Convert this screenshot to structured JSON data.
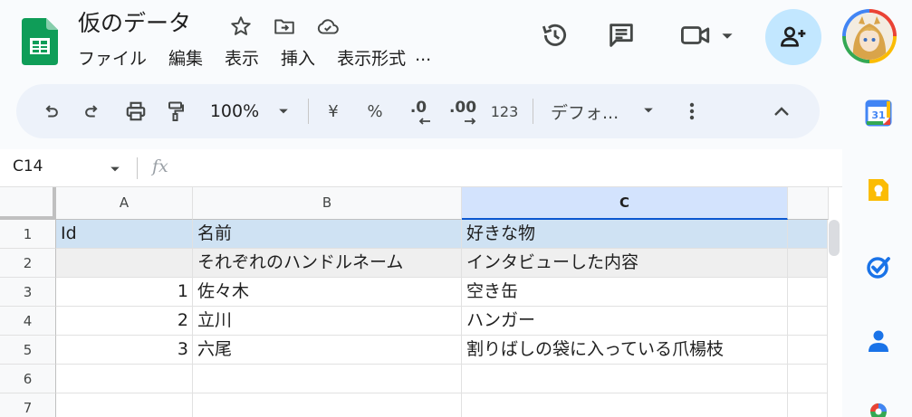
{
  "document": {
    "title": "仮のデータ"
  },
  "menu": [
    "ファイル",
    "編集",
    "表示",
    "挿入",
    "表示形式",
    "..."
  ],
  "toolbar": {
    "zoom": "100%",
    "currency": "¥",
    "percent": "%",
    "decrease_decimal": ".0",
    "increase_decimal": ".00",
    "number_format": "123",
    "font": "デフォ..."
  },
  "formula_bar": {
    "cell_ref": "C14",
    "fx": "fx"
  },
  "columns": [
    "A",
    "B",
    "C"
  ],
  "rows": [
    {
      "n": "1",
      "a": "Id",
      "b": "名前",
      "c": "好きな物"
    },
    {
      "n": "2",
      "a": "",
      "b": "それぞれのハンドルネーム",
      "c": "インタビューした内容"
    },
    {
      "n": "3",
      "a": "1",
      "b": "佐々木",
      "c": "空き缶"
    },
    {
      "n": "4",
      "a": "2",
      "b": "立川",
      "c": "ハンガー"
    },
    {
      "n": "5",
      "a": "3",
      "b": "六尾",
      "c": "割りばしの袋に入っている爪楊枝"
    },
    {
      "n": "6",
      "a": "",
      "b": "",
      "c": ""
    },
    {
      "n": "7",
      "a": "",
      "b": "",
      "c": ""
    }
  ],
  "side_panel": {
    "calendar_day": "31"
  },
  "colors": {
    "header_row_bg": "#cfe2f3",
    "row2_bg": "#efefef",
    "selected_col": "#d3e3fd",
    "sheets_green": "#0f9d58"
  }
}
